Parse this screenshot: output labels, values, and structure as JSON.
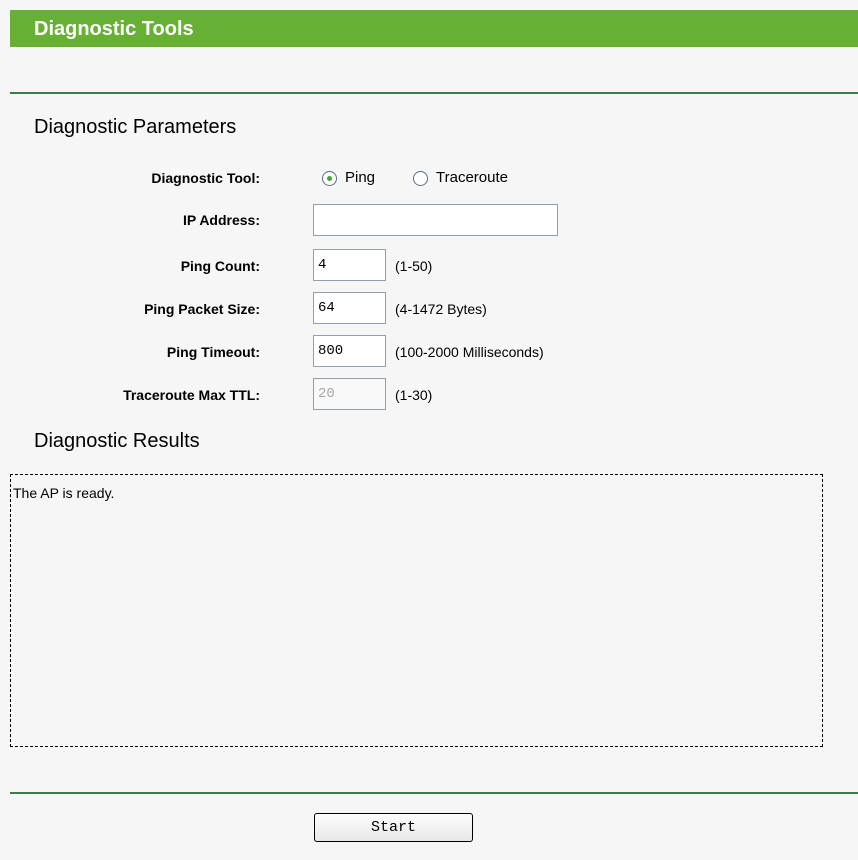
{
  "header": {
    "title": "Diagnostic Tools"
  },
  "parameters": {
    "section_title": "Diagnostic Parameters",
    "tool_label": "Diagnostic Tool:",
    "tool_options": [
      {
        "label": "Ping",
        "selected": true
      },
      {
        "label": "Traceroute",
        "selected": false
      }
    ],
    "ip_label": "IP Address:",
    "ip_value": "",
    "ping_count_label": "Ping Count:",
    "ping_count_value": "4",
    "ping_count_hint": "(1-50)",
    "packet_size_label": "Ping Packet Size:",
    "packet_size_value": "64",
    "packet_size_hint": "(4-1472 Bytes)",
    "timeout_label": "Ping Timeout:",
    "timeout_value": "800",
    "timeout_hint": "(100-2000 Milliseconds)",
    "max_ttl_label": "Traceroute Max TTL:",
    "max_ttl_value": "20",
    "max_ttl_hint": "(1-30)"
  },
  "results": {
    "section_title": "Diagnostic Results",
    "text": "The AP is ready."
  },
  "actions": {
    "start_label": "Start"
  },
  "colors": {
    "header_bg": "#66b133",
    "divider": "#3f7b4a",
    "radio_dot": "#3ba63b"
  }
}
